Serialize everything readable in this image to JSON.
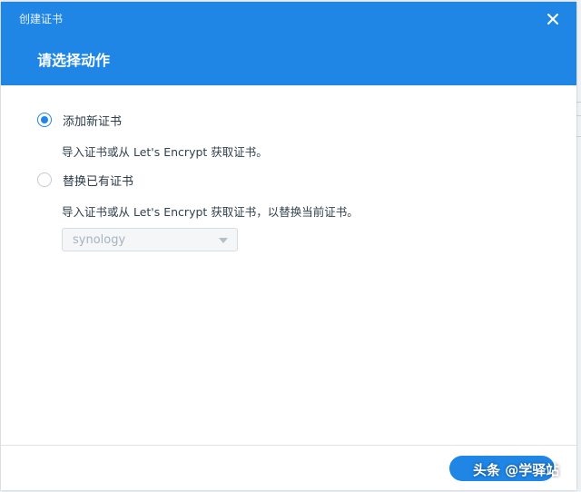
{
  "window": {
    "title": "创建证书",
    "close_icon": "close-icon"
  },
  "step": {
    "title": "请选择动作"
  },
  "options": [
    {
      "label": "添加新证书",
      "description": "导入证书或从 Let's Encrypt 获取证书。",
      "selected": true
    },
    {
      "label": "替换已有证书",
      "description": "导入证书或从 Let's Encrypt 获取证书，以替换当前证书。",
      "selected": false
    }
  ],
  "certificate_select": {
    "value": "synology",
    "disabled": true
  },
  "footer": {
    "next_label": ""
  },
  "watermark": "头条 @学驿站",
  "colors": {
    "accent": "#1f86e6",
    "header_bg": "#1f86e6"
  }
}
